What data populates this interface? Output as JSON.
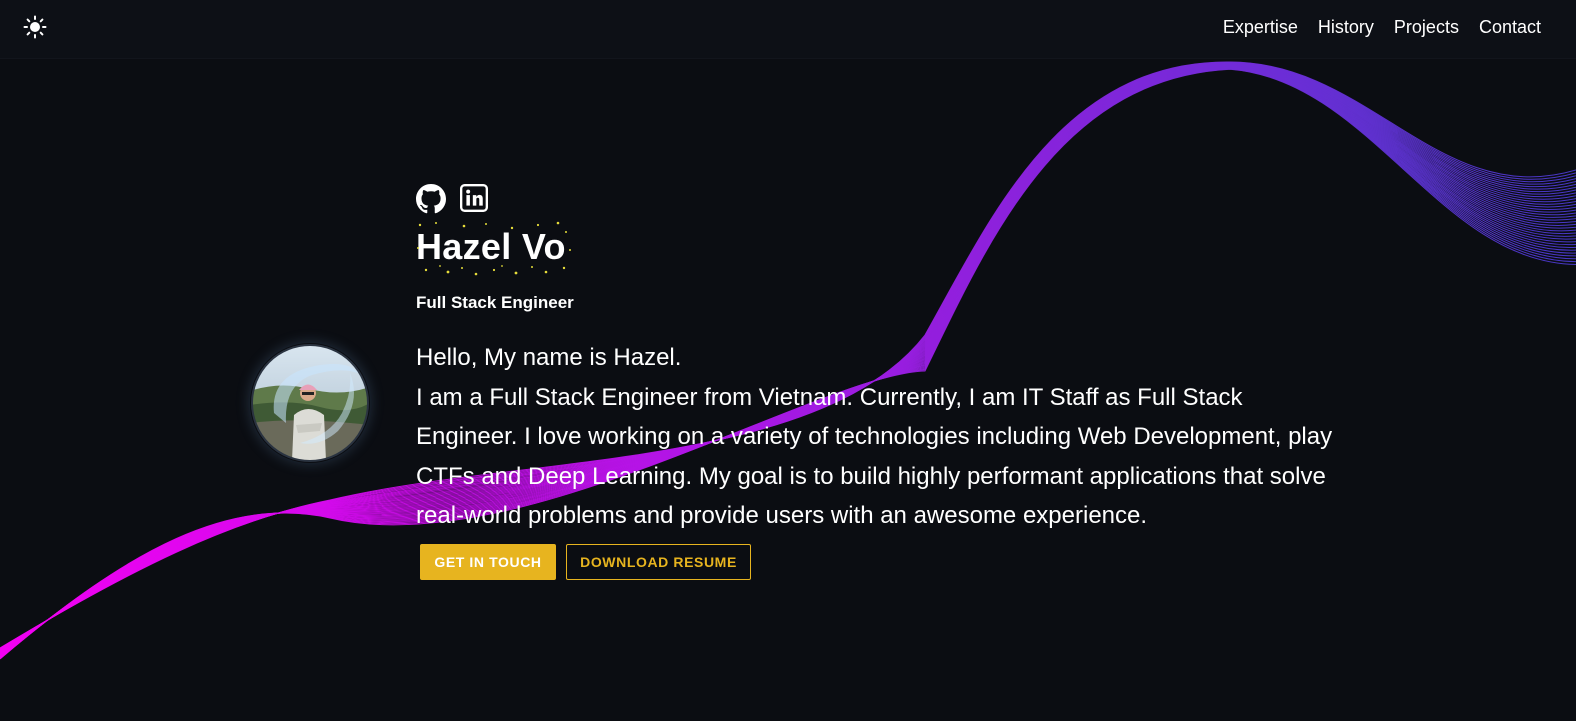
{
  "nav": {
    "theme_icon": "sun-icon",
    "links": [
      "Expertise",
      "History",
      "Projects",
      "Contact"
    ]
  },
  "social": {
    "icons": [
      "github-icon",
      "linkedin-icon"
    ]
  },
  "hero": {
    "name": "Hazel Vo",
    "role": "Full Stack Engineer",
    "greeting": "Hello, My name is Hazel.",
    "bio": "I am a Full Stack Engineer from Vietnam. Currently, I am IT Staff as Full Stack Engineer. I love working on a variety of technologies including Web Development, play CTFs and Deep Learning. My goal is to build highly performant applications that solve real-world problems and provide users with an awesome experience.",
    "primary_button": "GET IN TOUCH",
    "secondary_button": "DOWNLOAD RESUME"
  },
  "colors": {
    "background": "#0b0d12",
    "accent": "#e7b41f",
    "wave_start": "#f200f2",
    "wave_mid": "#9a1fe0",
    "wave_end": "#4a3ad0"
  }
}
